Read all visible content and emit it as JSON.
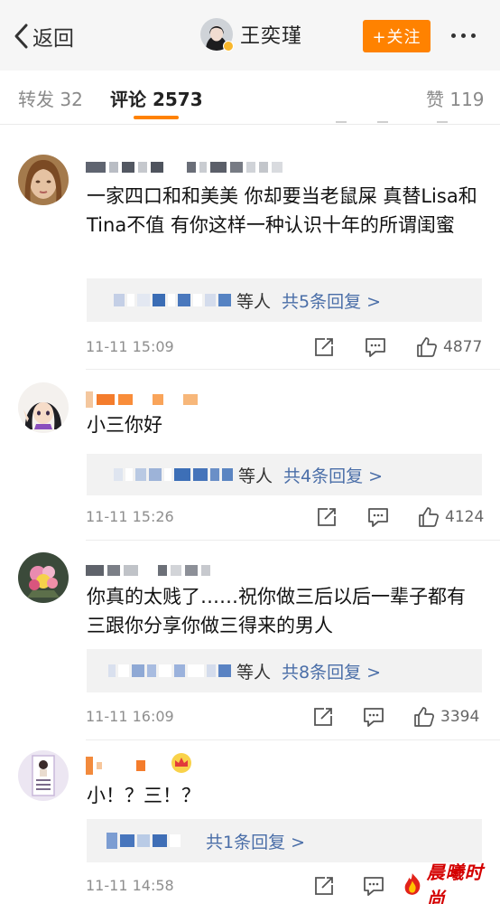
{
  "nav": {
    "back_label": "返回",
    "profile_name": "王奕瑾",
    "follow_label": "+关注"
  },
  "tabs": {
    "repost": "转发 32",
    "comments": "评论 2573",
    "likes": "赞 119"
  },
  "colors": {
    "accent": "#ff8200",
    "link": "#4a6ea8",
    "watermark": "#d40000"
  },
  "comments": [
    {
      "text": "一家四口和和美美 你却要当老鼠屎 真替Lisa和Tina不值 有你这样一种认识十年的所谓闺蜜",
      "reply_prefix": "等人",
      "reply_link": "共5条回复 >",
      "time": "11-11 15:09",
      "likes": "4877"
    },
    {
      "text": "小三你好",
      "reply_prefix": "等人",
      "reply_link": "共4条回复 >",
      "time": "11-11 15:26",
      "likes": "4124"
    },
    {
      "text": "你真的太贱了……祝你做三后以后一辈子都有三跟你分享你做三得来的男人",
      "reply_prefix": "等人",
      "reply_link": "共8条回复 >",
      "time": "11-11 16:09",
      "likes": "3394"
    },
    {
      "text": "小！？三！？",
      "reply_link": "共1条回复 >",
      "time": "11-11 14:58"
    }
  ],
  "watermark": {
    "text": "晨曦时尚"
  }
}
